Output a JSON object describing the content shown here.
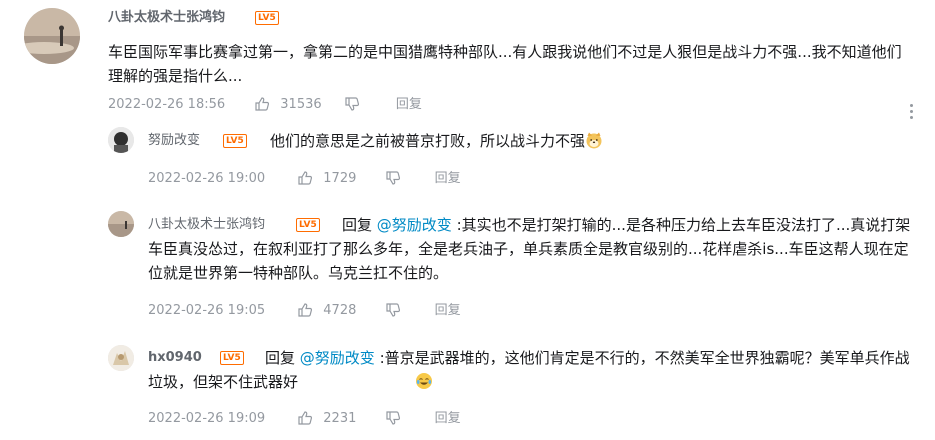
{
  "main_comment": {
    "username": "八卦太极术士张鸿钧",
    "level": "LV5",
    "text": "车臣国际军事比赛拿过第一，拿第二的是中国猎鹰特种部队...有人跟我说他们不过是人狠但是战斗力不强...我不知道他们理解的强是指什么...",
    "time": "2022-02-26 18:56",
    "likes": "31536",
    "reply_label": "回复"
  },
  "replies": [
    {
      "username": "努励改变",
      "level": "LV5",
      "text": "他们的意思是之前被普京打败，所以战斗力不强",
      "emoji": "doge-icon",
      "time": "2022-02-26 19:00",
      "likes": "1729",
      "reply_label": "回复"
    },
    {
      "username": "八卦太极术士张鸿钧",
      "level": "LV5",
      "reply_prefix": "回复",
      "mention": "@努励改变",
      "text": " :其实也不是打架打输的...是各种压力给上去车臣没法打了...真说打架车臣真没怂过，在叙利亚打了那么多年，全是老兵油子，单兵素质全是教官级别的...花样虐杀is...车臣这帮人现在定位就是世界第一特种部队。乌克兰扛不住的。",
      "time": "2022-02-26 19:05",
      "likes": "4728",
      "reply_label": "回复"
    },
    {
      "username": "hx0940",
      "level": "LV5",
      "reply_prefix": "回复",
      "mention": "@努励改变",
      "text": " :普京是武器堆的，这他们肯定是不行的，不然美军全世界独霸呢？美军单兵作战垃圾，但架不住武器好",
      "emoji": "laugh-cry-icon",
      "time": "2022-02-26 19:09",
      "likes": "2231",
      "reply_label": "回复"
    }
  ],
  "colors": {
    "level_badge": "#ff6c00",
    "mention": "#008ac5",
    "meta_text": "#9499a0",
    "username": "#61666d"
  }
}
